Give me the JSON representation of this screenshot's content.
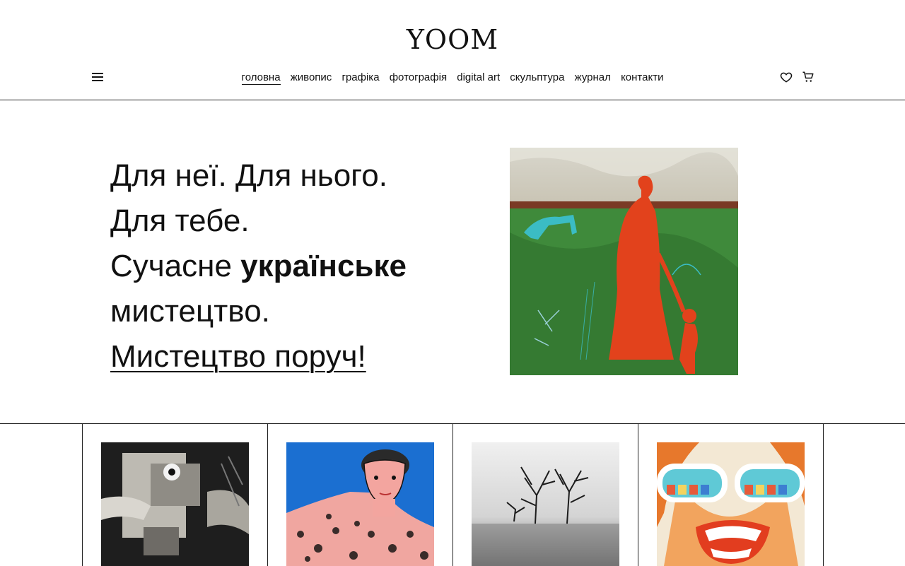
{
  "header": {
    "logo": "YOOM",
    "menu_icon": "hamburger-menu-icon",
    "nav": [
      {
        "label": "головна",
        "active": true
      },
      {
        "label": "живопис"
      },
      {
        "label": "графіка"
      },
      {
        "label": "фотографія"
      },
      {
        "label": "digital art"
      },
      {
        "label": "скульптура"
      },
      {
        "label": "журнал"
      },
      {
        "label": "контакти"
      }
    ],
    "wishlist_icon": "heart-icon",
    "cart_icon": "cart-icon"
  },
  "hero": {
    "line1": "Для неї. Для нього.",
    "line2": "Для тебе.",
    "line3_prefix": "Сучасне ",
    "line3_bold": "українське",
    "line4": "мистецтво.",
    "cta": "Мистецтво поруч!",
    "artwork": "painting-red-figure-with-child"
  },
  "gallery": [
    {
      "name": "artwork-abstract-bw"
    },
    {
      "name": "artwork-leopard-portrait"
    },
    {
      "name": "artwork-trees-in-water-photo"
    },
    {
      "name": "artwork-sunglasses-face"
    }
  ],
  "colors": {
    "text": "#111111",
    "border": "#222222",
    "background": "#ffffff"
  }
}
